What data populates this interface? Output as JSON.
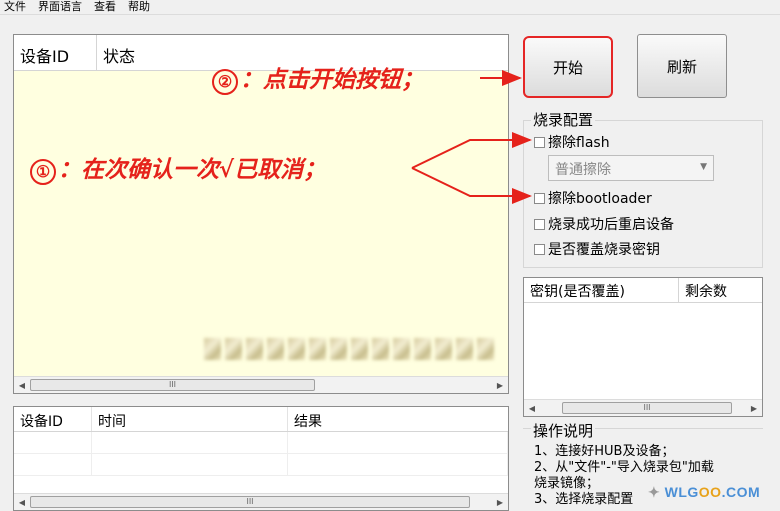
{
  "menu": [
    "文件",
    "界面语言",
    "查看",
    "帮助"
  ],
  "device_table": {
    "columns": [
      "设备ID",
      "状态"
    ],
    "scroll_thumb_label": "III"
  },
  "result_table": {
    "columns": [
      "设备ID",
      "时间",
      "结果"
    ],
    "scroll_thumb_label": "III"
  },
  "buttons": {
    "start": "开始",
    "refresh": "刷新"
  },
  "config": {
    "title": "烧录配置",
    "erase_flash": "擦除flash",
    "erase_mode": "普通擦除",
    "erase_bootloader": "擦除bootloader",
    "reboot_after": "烧录成功后重启设备",
    "overwrite_key": "是否覆盖烧录密钥"
  },
  "key_table": {
    "columns": [
      "密钥(是否覆盖)",
      "剩余数"
    ],
    "scroll_thumb_label": "III"
  },
  "help": {
    "title": "操作说明",
    "lines": [
      "1、连接好HUB及设备；",
      "2、从\"文件\"-\"导入烧录包\"加载",
      "烧录镜像；",
      "3、选择烧录配置"
    ]
  },
  "annotations": {
    "step1_num": "①",
    "step1_text": "：在次确认一次√已取消；",
    "step2_num": "②",
    "step2_text": "：点击开始按钮；"
  },
  "watermark": {
    "prefix": "WLG",
    "oo": "OO",
    "suffix": ".COM"
  },
  "colors": {
    "annotation_red": "#e5221b",
    "table_body": "#ffffe0",
    "watermark_blue": "#4a8fd6"
  }
}
